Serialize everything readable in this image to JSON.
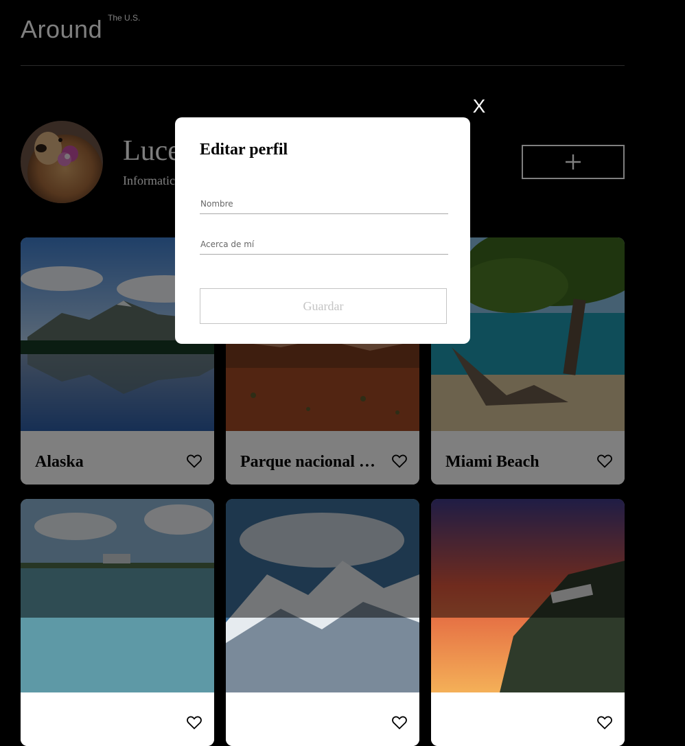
{
  "header": {
    "logo_text": "Around",
    "logo_superscript": "The U.S."
  },
  "profile": {
    "name": "Luce",
    "about": "Informatic",
    "add_button_icon": "plus-icon"
  },
  "cards": [
    {
      "title": "Alaska",
      "icon": "heart-icon"
    },
    {
      "title": "Parque nacional …",
      "icon": "heart-icon"
    },
    {
      "title": "Miami Beach",
      "icon": "heart-icon"
    },
    {
      "title": "",
      "icon": "heart-icon"
    },
    {
      "title": "",
      "icon": "heart-icon"
    },
    {
      "title": "",
      "icon": "heart-icon"
    }
  ],
  "modal": {
    "title": "Editar perfil",
    "name_placeholder": "Nombre",
    "about_placeholder": "Acerca de mí",
    "save_label": "Guardar",
    "close_label": "X"
  },
  "colors": {
    "background": "#000000",
    "modal_bg": "#ffffff",
    "overlay": "rgba(0,0,0,0.5)",
    "button_disabled": "#c4c4c4"
  }
}
